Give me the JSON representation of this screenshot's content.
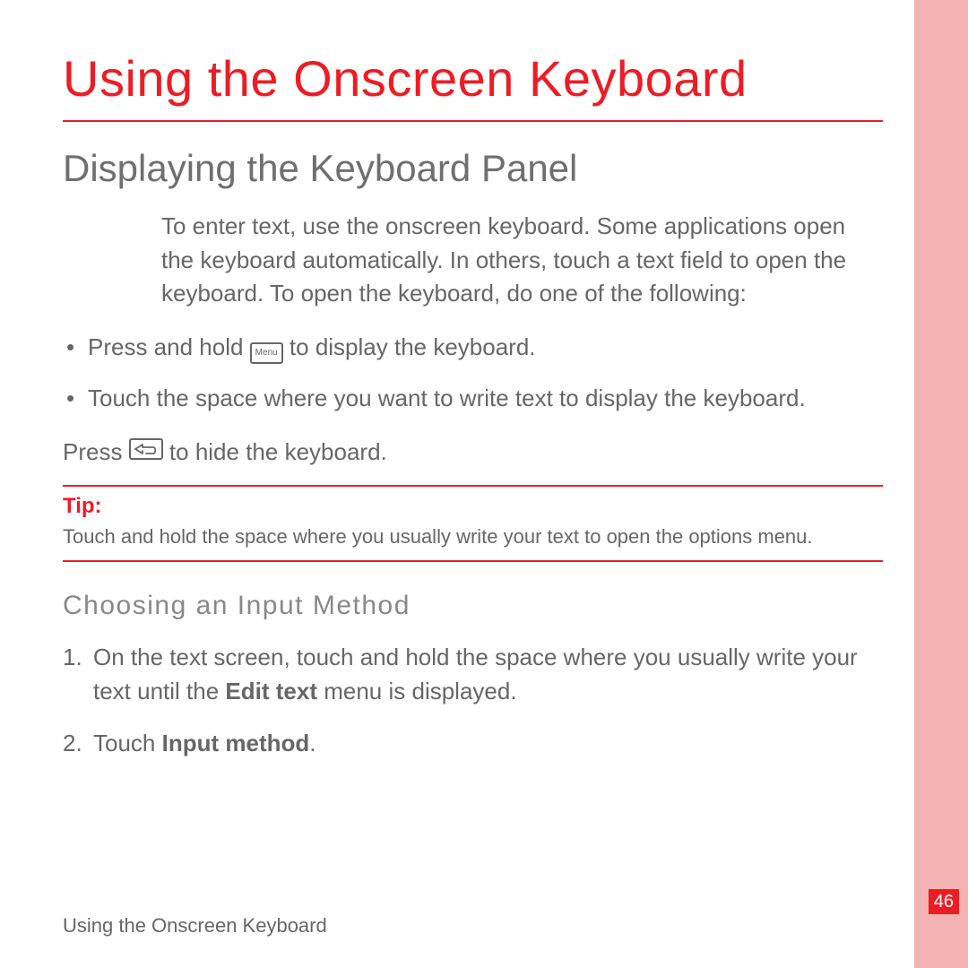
{
  "page": {
    "title": "Using the Onscreen Keyboard",
    "section1": {
      "heading": "Displaying the Keyboard Panel",
      "intro": "To enter text, use the onscreen keyboard. Some applications open the keyboard automatically. In others, touch a text field to open the keyboard. To open the keyboard, do one of the following:",
      "bullet1_before": "Press and hold ",
      "bullet1_after": " to display the keyboard.",
      "bullet2": "Touch the space where you want to write text to display the keyboard.",
      "hide_before": "Press ",
      "hide_after": " to hide the keyboard.",
      "tip_label": "Tip:",
      "tip_body": "Touch and hold the space where you usually write your text to open the options menu."
    },
    "section2": {
      "heading": "Choosing an Input Method",
      "item1_before": "On the text screen, touch and hold the space where you usually write your text until the ",
      "item1_bold": "Edit text",
      "item1_after": " menu is displayed.",
      "item2_before": "Touch ",
      "item2_bold": "Input method",
      "item2_after": "."
    },
    "footer": "Using the Onscreen Keyboard",
    "page_number": "46",
    "icons": {
      "menu_key_label": "Menu"
    }
  }
}
